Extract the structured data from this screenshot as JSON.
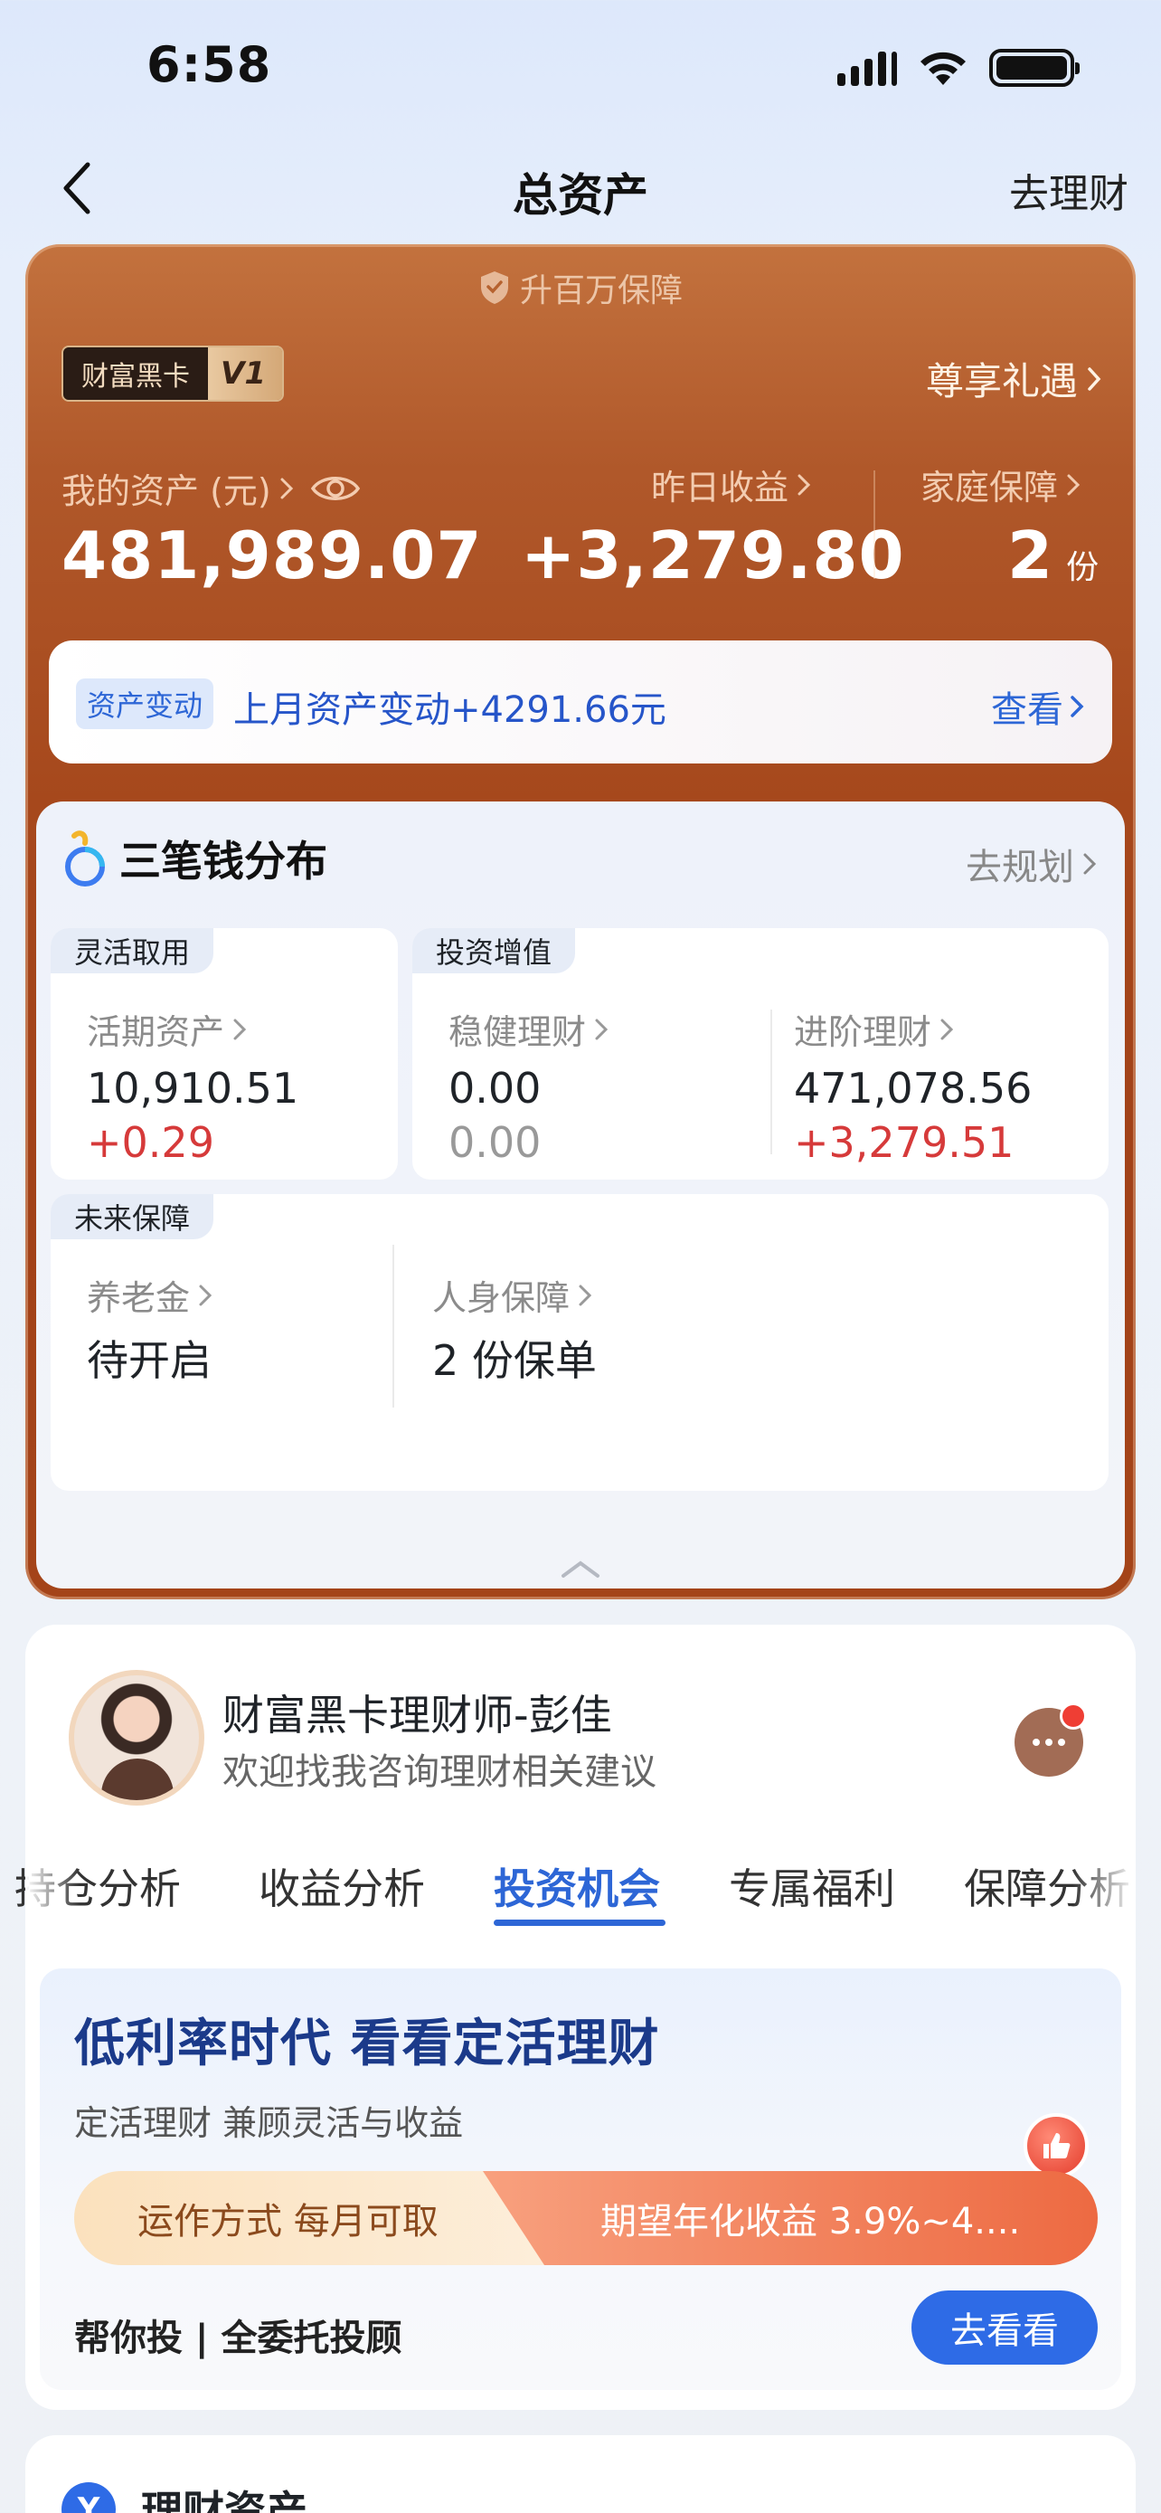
{
  "status_bar": {
    "time": "6:58"
  },
  "nav": {
    "title": "总资产",
    "right_link": "去理财"
  },
  "asset_card": {
    "upgrade_tip": "升百万保障",
    "vip_name": "财富黑卡",
    "vip_level": "V1",
    "privilege_link": "尊享礼遇",
    "my_assets_label": "我的资产 (元)",
    "my_assets_value": "481,989.07",
    "yesterday_label": "昨日收益",
    "yesterday_value": "+3,279.80",
    "family_label": "家庭保障",
    "family_value": "2",
    "family_unit": "份",
    "change_tag": "资产变动",
    "change_text": "上月资产变动+4291.66元",
    "change_link": "查看"
  },
  "distribution": {
    "title": "三笔钱分布",
    "link": "去规划",
    "flexible": {
      "tag": "灵活取用",
      "label": "活期资产",
      "value": "10,910.51",
      "gain": "+0.29"
    },
    "investment": {
      "tag": "投资增值",
      "steady_label": "稳健理财",
      "steady_value": "0.00",
      "steady_gain": "0.00",
      "advanced_label": "进阶理财",
      "advanced_value": "471,078.56",
      "advanced_gain": "+3,279.51"
    },
    "future": {
      "tag": "未来保障",
      "pension_label": "养老金",
      "pension_value": "待开启",
      "personal_label": "人身保障",
      "personal_value": "2 份保单"
    }
  },
  "advisor": {
    "name": "财富黑卡理财师-彭佳",
    "desc": "欢迎找我咨询理财相关建议"
  },
  "tabs": [
    {
      "label": "持仓分析"
    },
    {
      "label": "收益分析"
    },
    {
      "label": "投资机会",
      "active": true
    },
    {
      "label": "专属福利"
    },
    {
      "label": "保障分析"
    }
  ],
  "promo": {
    "title": "低利率时代 看看定活理财",
    "subtitle": "定活理财 兼顾灵活与收益",
    "method": "运作方式  每月可取",
    "yield": "期望年化收益  3.9%~4....",
    "footer": "帮你投 | 全委托投顾",
    "button": "去看看"
  },
  "peek": {
    "icon_letter": "Y",
    "title": "理财资产"
  },
  "colors": {
    "accent_blue": "#2d66d6",
    "card_brown": "#a6481c",
    "gain_red": "#d63a3a"
  }
}
